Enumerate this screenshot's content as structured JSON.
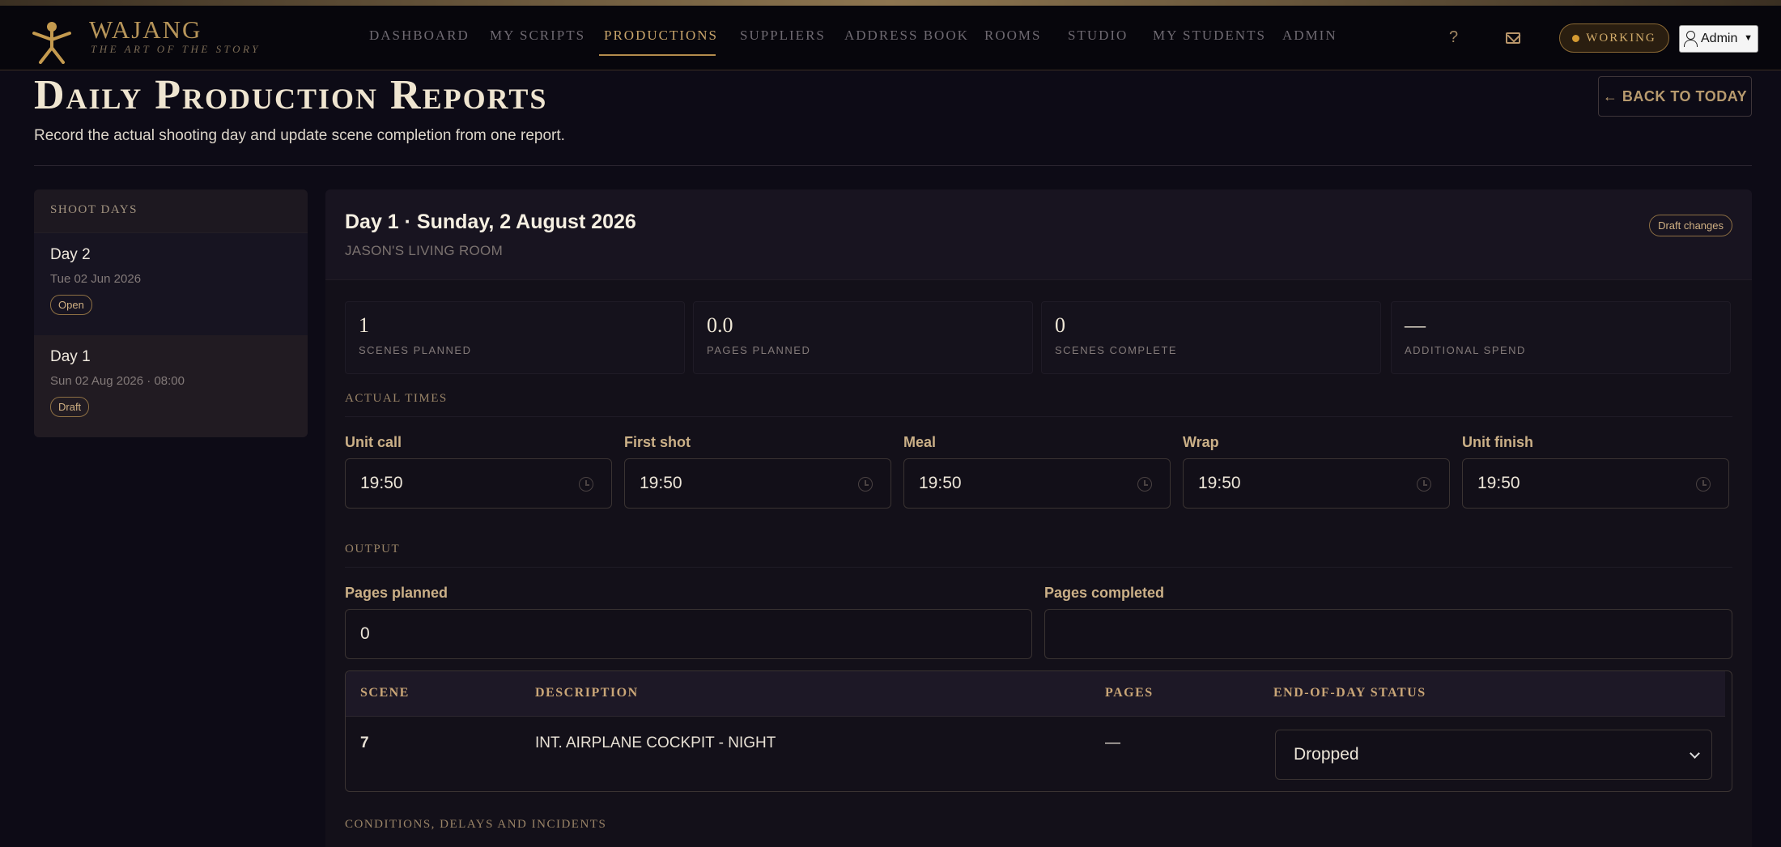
{
  "brand": {
    "name": "WAJANG",
    "tagline": "THE ART OF THE STORY"
  },
  "nav": {
    "items": [
      "DASHBOARD",
      "MY SCRIPTS",
      "PRODUCTIONS",
      "SUPPLIERS",
      "ADDRESS BOOK",
      "ROOMS",
      "STUDIO",
      "MY STUDENTS",
      "ADMIN"
    ],
    "active": "PRODUCTIONS",
    "help": "?",
    "status": "WORKING",
    "user_select": "Admin"
  },
  "page": {
    "title": "Daily Production Reports",
    "subtitle": "Record the actual shooting day and update scene completion from one report.",
    "back_button": "← BACK TO TODAY"
  },
  "shoot_days": {
    "heading": "SHOOT DAYS",
    "items": [
      {
        "name": "Day 2",
        "date": "Tue 02 Jun 2026",
        "status": "Open"
      },
      {
        "name": "Day 1",
        "date": "Sun 02 Aug 2026 · 08:00",
        "status": "Draft"
      }
    ]
  },
  "report": {
    "title": "Day 1 · Sunday, 2 August 2026",
    "location": "JASON'S LIVING ROOM",
    "badge": "Draft changes",
    "stats": [
      {
        "value": "1",
        "label": "SCENES PLANNED"
      },
      {
        "value": "0.0",
        "label": "PAGES PLANNED"
      },
      {
        "value": "0",
        "label": "SCENES COMPLETE"
      },
      {
        "value": "—",
        "label": "ADDITIONAL SPEND"
      }
    ],
    "actual_times": {
      "heading": "ACTUAL TIMES",
      "fields": [
        {
          "label": "Unit call",
          "value": "19:50"
        },
        {
          "label": "First shot",
          "value": "19:50"
        },
        {
          "label": "Meal",
          "value": "19:50"
        },
        {
          "label": "Wrap",
          "value": "19:50"
        },
        {
          "label": "Unit finish",
          "value": "19:50"
        }
      ]
    },
    "output": {
      "heading": "OUTPUT",
      "pages_planned_label": "Pages planned",
      "pages_planned_value": "0",
      "pages_completed_label": "Pages completed",
      "pages_completed_value": ""
    },
    "scenes_table": {
      "columns": [
        "SCENE",
        "DESCRIPTION",
        "PAGES",
        "END-OF-DAY STATUS"
      ],
      "rows": [
        {
          "scene": "7",
          "description": "INT. AIRPLANE COCKPIT - NIGHT",
          "pages": "—",
          "status": "Dropped"
        }
      ]
    },
    "conditions_heading": "CONDITIONS, DELAYS AND INCIDENTS"
  },
  "colors": {
    "accent": "#c9a56b",
    "background": "#0d0b16",
    "panel": "#131019"
  }
}
